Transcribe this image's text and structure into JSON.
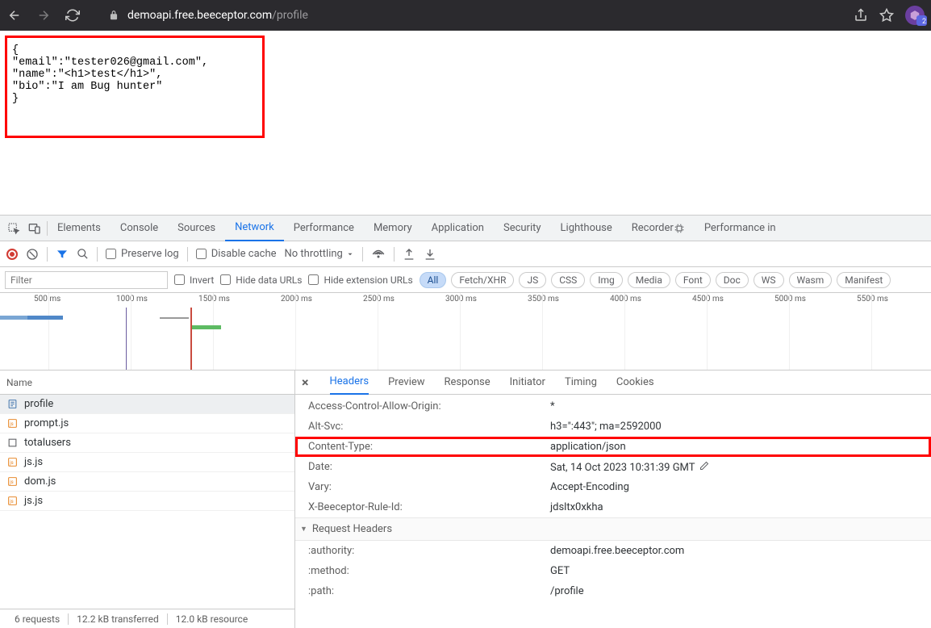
{
  "browser": {
    "url_domain": "demoapi.free.beeceptor.com",
    "url_path": "/profile",
    "ext_badge": "2"
  },
  "page": {
    "json_text": "{\n\"email\":\"tester026@gmail.com\",\n\"name\":\"<h1>test</h1>\",\n\"bio\":\"I am Bug hunter\"\n}"
  },
  "devtools": {
    "tabs": [
      "Elements",
      "Console",
      "Sources",
      "Network",
      "Performance",
      "Memory",
      "Application",
      "Security",
      "Lighthouse",
      "Recorder",
      "Performance in"
    ],
    "active_tab": "Network",
    "toolbar": {
      "preserve_log": "Preserve log",
      "disable_cache": "Disable cache",
      "throttling": "No throttling"
    },
    "filter": {
      "placeholder": "Filter",
      "invert": "Invert",
      "hide_data": "Hide data URLs",
      "hide_ext": "Hide extension URLs",
      "pills": [
        "All",
        "Fetch/XHR",
        "JS",
        "CSS",
        "Img",
        "Media",
        "Font",
        "Doc",
        "WS",
        "Wasm",
        "Manifest"
      ],
      "active_pill": "All"
    },
    "timeline_ticks": [
      "500 ms",
      "1000 ms",
      "1500 ms",
      "2000 ms",
      "2500 ms",
      "3000 ms",
      "3500 ms",
      "4000 ms",
      "4500 ms",
      "5000 ms",
      "5500 ms"
    ],
    "name_header": "Name",
    "requests": [
      {
        "name": "profile",
        "type": "doc"
      },
      {
        "name": "prompt.js",
        "type": "js"
      },
      {
        "name": "totalusers",
        "type": "other"
      },
      {
        "name": "js.js",
        "type": "js"
      },
      {
        "name": "dom.js",
        "type": "js"
      },
      {
        "name": "js.js",
        "type": "js"
      }
    ],
    "detail_tabs": [
      "Headers",
      "Preview",
      "Response",
      "Initiator",
      "Timing",
      "Cookies"
    ],
    "active_detail": "Headers",
    "response_headers": [
      {
        "k": "Access-Control-Allow-Origin:",
        "v": "*"
      },
      {
        "k": "Alt-Svc:",
        "v": "h3=\":443\"; ma=2592000"
      },
      {
        "k": "Content-Type:",
        "v": "application/json",
        "boxed": true
      },
      {
        "k": "Date:",
        "v": "Sat, 14 Oct 2023 10:31:39 GMT",
        "pencil": true
      },
      {
        "k": "Vary:",
        "v": "Accept-Encoding"
      },
      {
        "k": "X-Beeceptor-Rule-Id:",
        "v": "jdsltx0xkha"
      }
    ],
    "request_headers_label": "Request Headers",
    "request_headers": [
      {
        "k": ":authority:",
        "v": "demoapi.free.beeceptor.com"
      },
      {
        "k": ":method:",
        "v": "GET"
      },
      {
        "k": ":path:",
        "v": "/profile"
      }
    ],
    "status": {
      "requests": "6 requests",
      "transferred": "12.2 kB transferred",
      "resources": "12.0 kB resource"
    }
  }
}
